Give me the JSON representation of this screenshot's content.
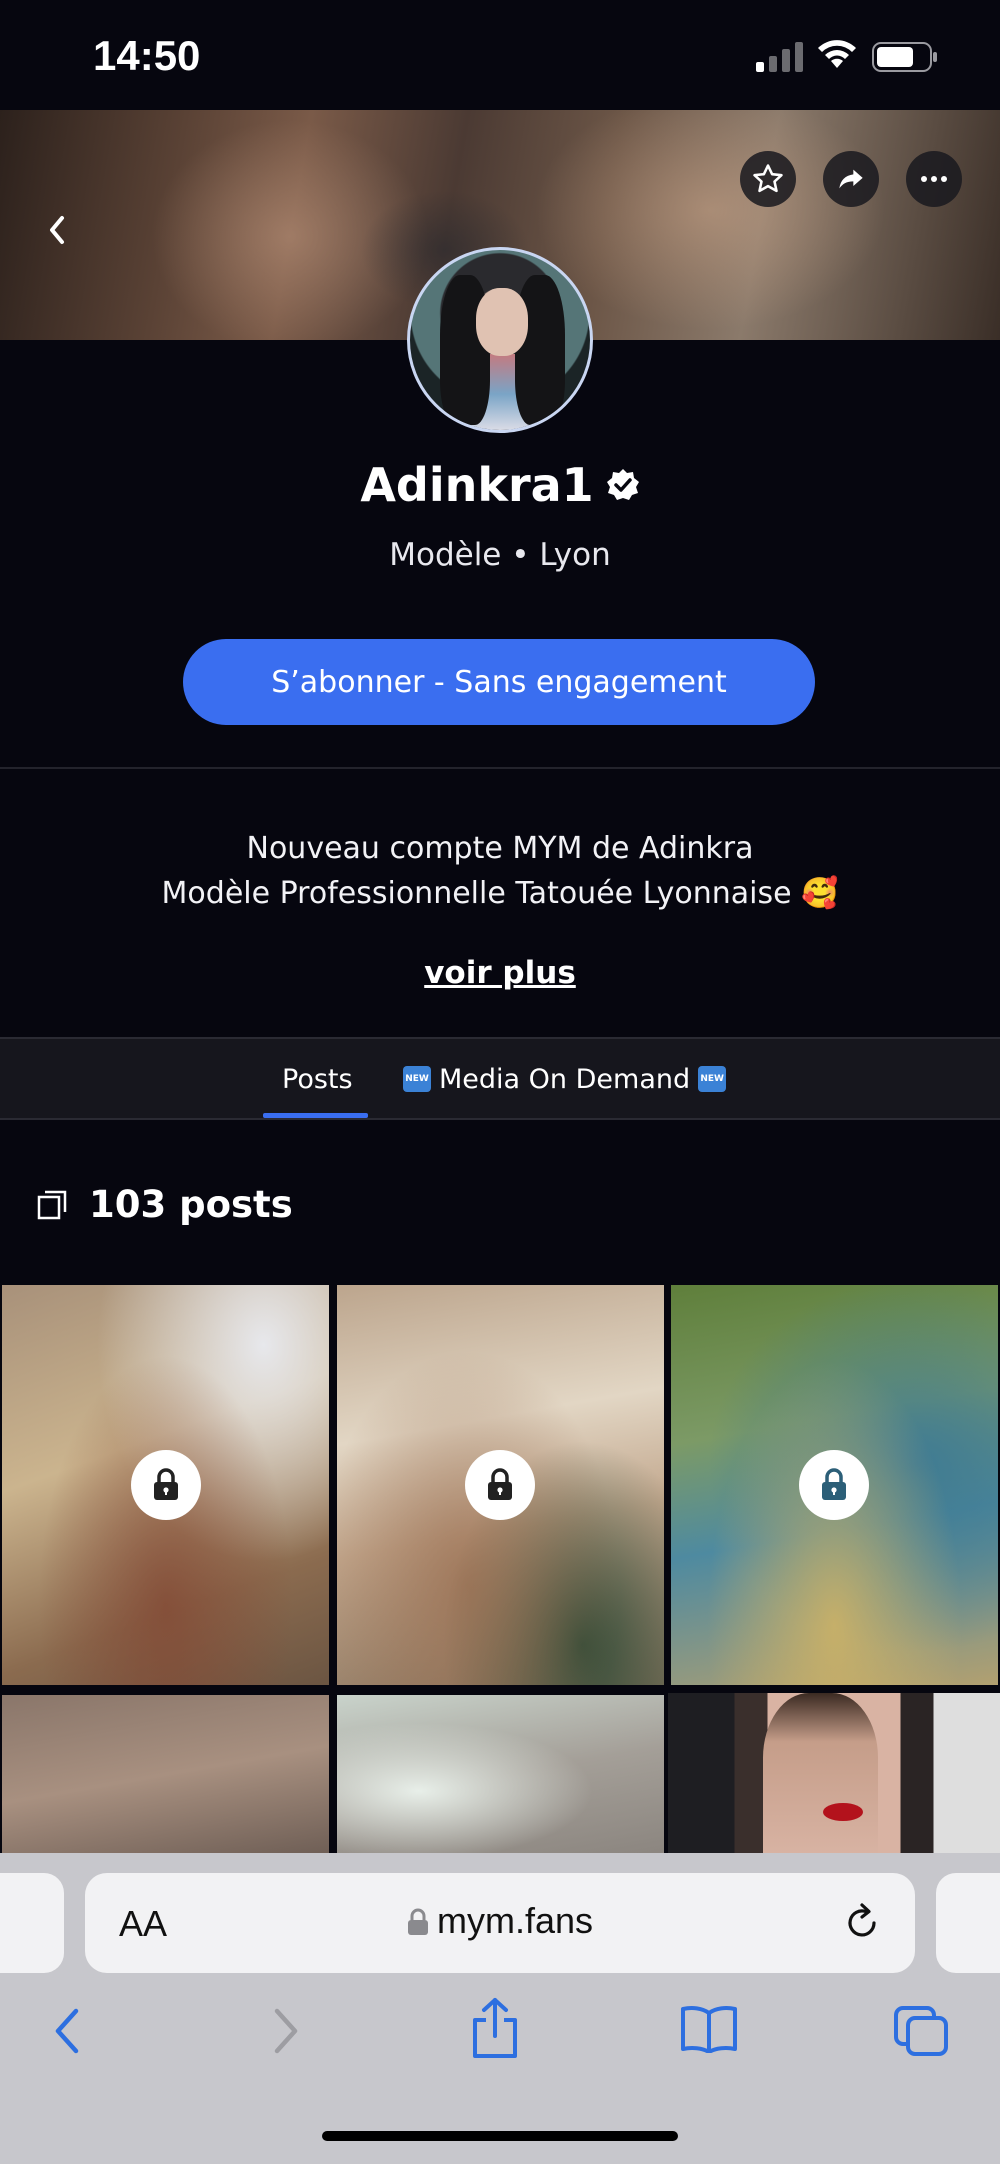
{
  "status_bar": {
    "time": "14:50"
  },
  "profile": {
    "name": "Adinkra1",
    "subtitle": "Modèle • Lyon",
    "subscribe_label": "S’abonner - Sans engagement",
    "bio_line1": "Nouveau compte MYM de Adinkra",
    "bio_line2": "Modèle Professionnelle Tatouée Lyonnaise 🥰",
    "more_label": "voir plus"
  },
  "tabs": {
    "posts_label": "Posts",
    "media_label": "Media On Demand",
    "new_badge": "NEW"
  },
  "posts": {
    "count_label": "103 posts"
  },
  "browser": {
    "text_size_label": "AA",
    "url": "mym.fans"
  },
  "colors": {
    "accent": "#3a6ef0",
    "background": "#06060f"
  }
}
